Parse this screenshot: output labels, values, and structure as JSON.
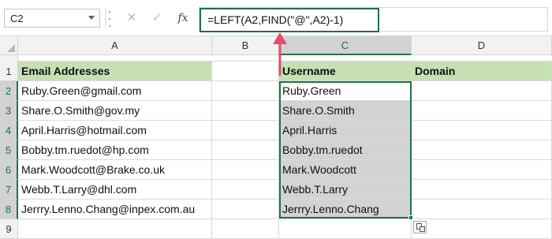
{
  "formula_bar": {
    "name_box": "C2",
    "cancel_icon": "✕",
    "enter_icon": "✓",
    "fx_label": "fx",
    "formula": "=LEFT(A2,FIND(\"@\",A2)-1)"
  },
  "columns": [
    "A",
    "B",
    "C",
    "D"
  ],
  "selected_column": "C",
  "rows": [
    "1",
    "2",
    "3",
    "4",
    "5",
    "6",
    "7",
    "8",
    "9"
  ],
  "headers": {
    "email": "Email Addresses",
    "username": "Username",
    "domain": "Domain"
  },
  "emails": [
    "Ruby.Green@gmail.com",
    "Share.O.Smith@gov.my",
    "April.Harris@hotmail.com",
    "Bobby.tm.ruedot@hp.com",
    "Mark.Woodcott@Brake.co.uk",
    "Webb.T.Larry@dhl.com",
    "Jerrry.Lenno.Chang@inpex.com.au"
  ],
  "usernames": [
    "Ruby.Green",
    "Share.O.Smith",
    "April.Harris",
    "Bobby.tm.ruedot",
    "Mark.Woodcott",
    "Webb.T.Larry",
    "Jerrry.Lenno.Chang"
  ],
  "colors": {
    "header_fill": "#c6e0b4",
    "selection_border": "#217346",
    "selection_shade": "#d3d3d3",
    "arrow": "#e0506a"
  },
  "icons": {
    "paste_options": "paste-options-icon",
    "callout_arrow": "arrow-up-icon"
  }
}
